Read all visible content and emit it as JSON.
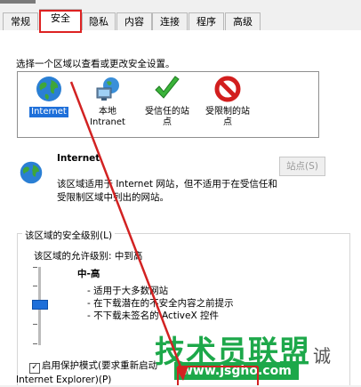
{
  "tabs": [
    {
      "label": "常规",
      "active": false
    },
    {
      "label": "安全",
      "active": true
    },
    {
      "label": "隐私",
      "active": false
    },
    {
      "label": "内容",
      "active": false
    },
    {
      "label": "连接",
      "active": false
    },
    {
      "label": "程序",
      "active": false
    },
    {
      "label": "高级",
      "active": false
    }
  ],
  "instruction": "选择一个区域以查看或更改安全设置。",
  "zones": [
    {
      "label_line1": "Internet",
      "label_line2": "",
      "icon": "globe-icon",
      "selected": true
    },
    {
      "label_line1": "本地",
      "label_line2": "Intranet",
      "icon": "network-computer-icon",
      "selected": false
    },
    {
      "label_line1": "受信任的站",
      "label_line2": "点",
      "icon": "check-icon",
      "selected": false
    },
    {
      "label_line1": "受限制的站",
      "label_line2": "点",
      "icon": "restricted-icon",
      "selected": false
    }
  ],
  "zone_info": {
    "name": "Internet",
    "description": "该区域适用于 Internet 网站，但不适用于在受信任和受限制区域中列出的网站。",
    "sites_button": "站点(S)"
  },
  "security_level": {
    "group_label": "该区域的安全级别(L)",
    "allowed": "该区域的允许级别: 中到高",
    "level": "中-高",
    "bullets": [
      "- 适用于大多数网站",
      "- 在下载潜在的不安全内容之前提示",
      "- 不下载未签名的 ActiveX 控件"
    ],
    "slider_position": "中-高"
  },
  "protected_mode": {
    "line1": "启用保护模式(要求重新启动",
    "line2": "Internet Explorer)(P)",
    "checked": true
  },
  "watermark": {
    "text": "技术员联盟",
    "url": "www.jsgho.com",
    "suffix": "诚"
  },
  "colors": {
    "highlight": "#d22222",
    "selection": "#1e6fd9",
    "watermark": "#1da84a"
  }
}
